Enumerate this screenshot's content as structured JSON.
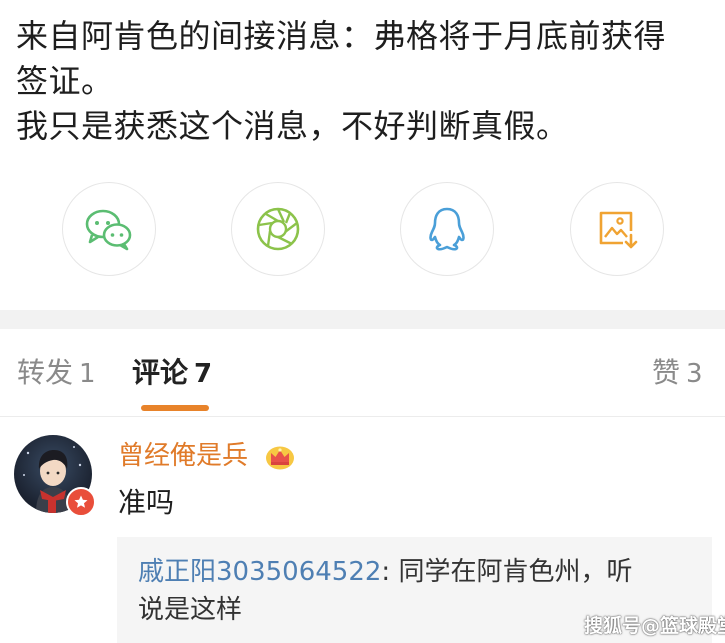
{
  "post": {
    "lines": [
      "来自阿肯色的间接消息：弗格将于月底前获得",
      "签证。",
      "我只是获悉这个消息，不好判断真假。"
    ]
  },
  "share": {
    "buttons": [
      {
        "icon": "wechat-icon",
        "color": "#5bbd72"
      },
      {
        "icon": "moments-aperture-icon",
        "color": "#8cc34b"
      },
      {
        "icon": "qq-penguin-icon",
        "color": "#4a9fd8"
      },
      {
        "icon": "save-image-icon",
        "color": "#f0a332"
      }
    ]
  },
  "tabs": {
    "repost": {
      "label": "转发",
      "count": "1"
    },
    "comment": {
      "label": "评论",
      "count": "7"
    },
    "like": {
      "label": "赞",
      "count": "3"
    },
    "accent": "#e8832a"
  },
  "comment": {
    "username": "曾经俺是兵",
    "username_color": "#e07b2a",
    "text": "准吗",
    "reply": {
      "user": "戚正阳3035064522",
      "separator": ": ",
      "text_line1": "同学在阿肯色州，听",
      "text_line2": "说是这样",
      "user_color": "#4e7fb3"
    }
  },
  "watermark": {
    "text": "搜狐号@篮球殿堂"
  }
}
